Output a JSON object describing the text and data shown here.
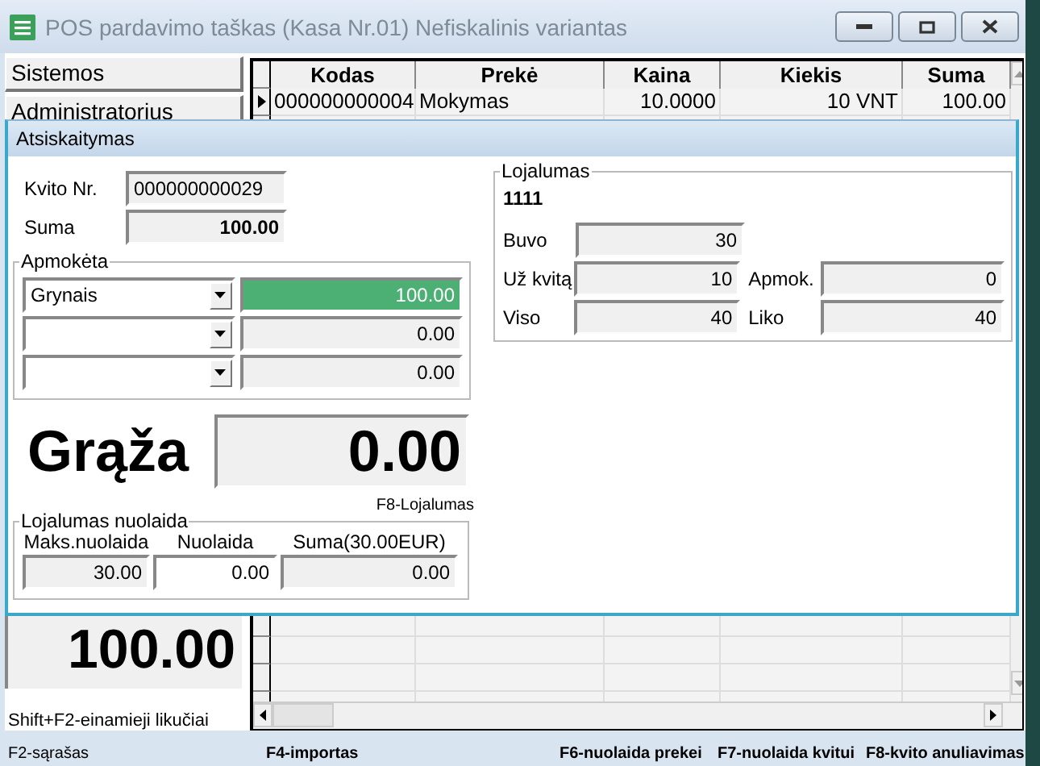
{
  "window": {
    "title": "POS pardavimo taškas (Kasa Nr.01) Nefiskalinis variantas"
  },
  "sidebar": {
    "items": [
      "Sistemos",
      "Administratorius"
    ]
  },
  "grid": {
    "columns": [
      "Kodas",
      "Prekė",
      "Kaina",
      "Kiekis",
      "Suma"
    ],
    "rows": [
      {
        "cells": [
          "000000000004",
          "Mokymas",
          "10.0000",
          "10 VNT",
          "100.00"
        ],
        "selected": true
      }
    ]
  },
  "total": "100.00",
  "hints": [
    "Shift+F2-einamieji likučiai",
    "F2-sąrašas"
  ],
  "shortcuts": [
    "F4-importas",
    "F6-nuolaida prekei",
    "F7-nuolaida kvitui",
    "F8-kvito anuliavimas"
  ],
  "dialog": {
    "title": "Atsiskaitymas",
    "receipt": {
      "label": "Kvito Nr.",
      "value": "000000000029"
    },
    "sum": {
      "label": "Suma",
      "value": "100.00"
    },
    "payment": {
      "title": "Apmokėta",
      "rows": [
        {
          "method": "Grynais",
          "amount": "100.00",
          "selected": true
        },
        {
          "amount": "0.00",
          "selected": false
        },
        {
          "amount": "0.00",
          "selected": false
        }
      ]
    },
    "change": {
      "label": "Grąža",
      "value": "0.00"
    },
    "loyalty_hint": "F8-Lojalumas",
    "loyalty": {
      "title": "Lojalumas",
      "card": "1111",
      "rows": [
        [
          {
            "label": "Buvo",
            "value": "30"
          }
        ],
        [
          {
            "label": "Už kvitą",
            "value": "10"
          },
          {
            "label": "Apmok.",
            "value": "0"
          }
        ],
        [
          {
            "label": "Viso",
            "value": "40"
          },
          {
            "label": "Liko",
            "value": "40"
          }
        ]
      ]
    },
    "loyalty_discount": {
      "title": "Lojalumas nuolaida",
      "columns": [
        {
          "label": "Maks.nuolaida",
          "value": "30.00",
          "editable": false
        },
        {
          "label": "Nuolaida",
          "value": "0.00",
          "editable": true
        },
        {
          "label": "Suma(30.00EUR)",
          "value": "0.00",
          "editable": false
        }
      ]
    }
  }
}
